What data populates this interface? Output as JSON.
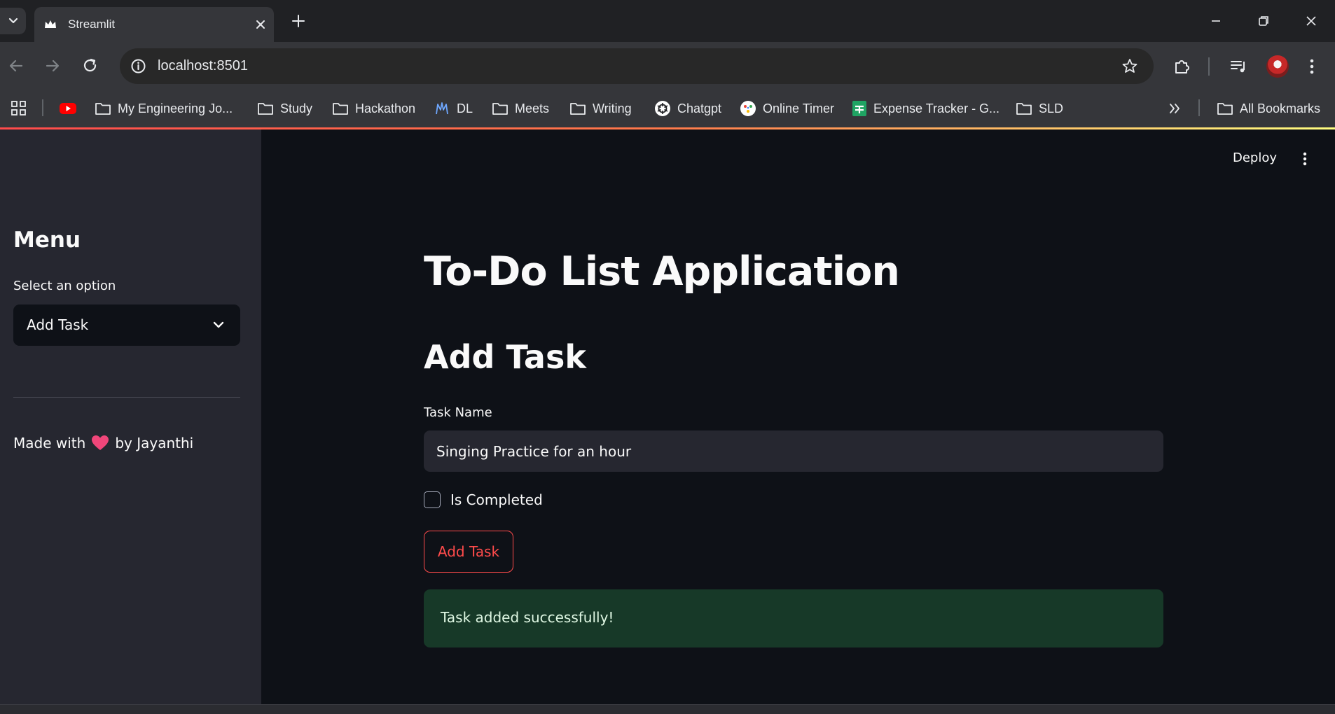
{
  "browser": {
    "tab_title": "Streamlit",
    "url": "localhost:8501"
  },
  "bookmarks": [
    {
      "label": "",
      "icon": "youtube-icon"
    },
    {
      "label": "My Engineering Jo...",
      "icon": "folder-icon"
    },
    {
      "label": "Study",
      "icon": "folder-icon"
    },
    {
      "label": "Hackathon",
      "icon": "folder-icon"
    },
    {
      "label": "DL",
      "icon": "dl-icon"
    },
    {
      "label": "Meets",
      "icon": "folder-icon"
    },
    {
      "label": "Writing",
      "icon": "folder-icon"
    },
    {
      "label": "Chatgpt",
      "icon": "chatgpt-icon"
    },
    {
      "label": "Online Timer",
      "icon": "timer-icon"
    },
    {
      "label": "Expense Tracker - G...",
      "icon": "sheets-icon"
    },
    {
      "label": "SLD",
      "icon": "folder-icon"
    }
  ],
  "all_bookmarks_label": "All Bookmarks",
  "sidebar": {
    "title": "Menu",
    "select_label": "Select an option",
    "selected_option": "Add Task",
    "footer_prefix": "Made with",
    "footer_suffix": "by Jayanthi"
  },
  "header": {
    "deploy_label": "Deploy"
  },
  "main": {
    "title": "To-Do List Application",
    "subtitle": "Add Task",
    "task_name_label": "Task Name",
    "task_name_value": "Singing Practice for an hour",
    "completed_label": "Is Completed",
    "completed_checked": false,
    "add_button_label": "Add Task",
    "success_message": "Task added successfully!"
  },
  "colors": {
    "primary": "#ff4b4b",
    "background": "#0e1117",
    "sidebar": "#262730",
    "success_bg": "#173928"
  }
}
